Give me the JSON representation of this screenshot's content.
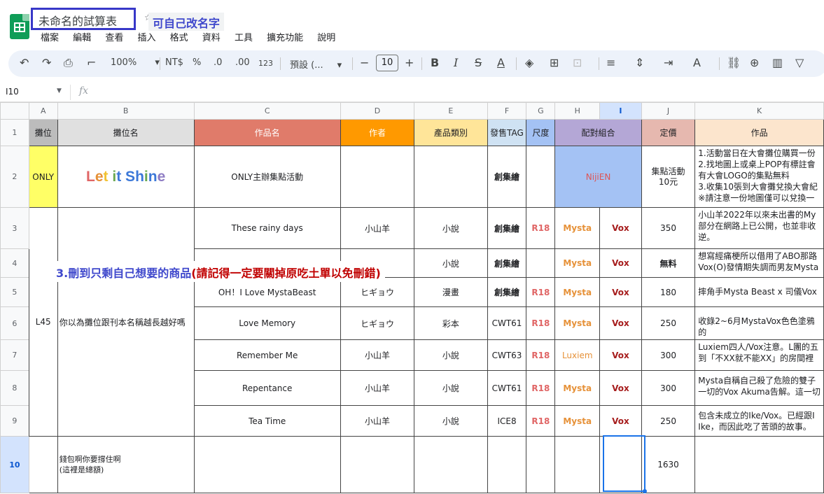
{
  "doc": {
    "title": "未命名的試算表",
    "star": "☆",
    "annotation": "可自己改名字"
  },
  "menu": [
    "檔案",
    "編輯",
    "查看",
    "插入",
    "格式",
    "資料",
    "工具",
    "擴充功能",
    "說明"
  ],
  "toolbar": {
    "zoom": "100%",
    "currency": "NT$",
    "percent": "%",
    "dec_less": ".0",
    "dec_more": ".00",
    "num_format": "123",
    "font": "預設 (...",
    "font_size": "10"
  },
  "formula_bar": {
    "cell_ref": "I10",
    "fx": "fx"
  },
  "columns": [
    "A",
    "B",
    "C",
    "D",
    "E",
    "F",
    "G",
    "H",
    "I",
    "J",
    "K"
  ],
  "header_row": {
    "a": "攤位",
    "b": "攤位名",
    "c": "作品名",
    "d": "作者",
    "e": "產品類別",
    "f": "發售TAG",
    "g": "尺度",
    "h": "配對組合",
    "j": "定價",
    "k": "作品"
  },
  "rows": [
    {
      "num": "2",
      "a": "ONLY",
      "b_letters": [
        "L",
        "e",
        "t",
        " ",
        "i",
        "t",
        " ",
        "S",
        "h",
        "i",
        "n",
        "e"
      ],
      "c": "ONLY主辦集點活動",
      "f": "創集繪",
      "h": "NijiEN",
      "j": "集點活動\n10元",
      "k": "1.活動當日在大會攤位購買一份\n2.找地圖上或桌上POP有標註會\n有大會LOGO的集點無料\n3.收集10張到大會攤兌換大會紀\n※請注意一份地圖僅可以兌換一"
    },
    {
      "num": "3",
      "c": "These rainy days",
      "d": "小山羊",
      "e": "小說",
      "f": "創集繪",
      "g": "R18",
      "h": "Mysta",
      "i": "Vox",
      "j": "350",
      "k": "小山羊2022年以來未出書的My\n部分在網路上已公開，也並非收\n逆。"
    },
    {
      "num": "4",
      "e": "小說",
      "f": "創集繪",
      "h": "Mysta",
      "i": "Vox",
      "j": "無料",
      "k": "想寫經痛梗所以借用了ABO那路\nVox(O)發情期失調而男友Mysta"
    },
    {
      "num": "5",
      "c": "OH！I Love MystaBeast",
      "d": "ヒギョウ",
      "e": "漫畫",
      "f": "創集繪",
      "g": "R18",
      "h": "Mysta",
      "i": "Vox",
      "j": "180",
      "k": "摔角手Mysta Beast x 司儀Vox"
    },
    {
      "num": "6",
      "a": "L45",
      "b": "你以為攤位跟刊本名稱越長越好嗎",
      "c": "Love Memory",
      "d": "ヒギョウ",
      "e": "彩本",
      "f": "CWT61",
      "g": "R18",
      "h": "Mysta",
      "i": "Vox",
      "j": "250",
      "k": "收錄2~6月MystaVox色色塗鴉的"
    },
    {
      "num": "7",
      "c": "Remember Me",
      "d": "小山羊",
      "e": "小說",
      "f": "CWT63",
      "g": "R18",
      "h": "Luxiem",
      "i": "Vox",
      "j": "300",
      "k": "Luxiem四人/Vox注意。L團的五\n到「不XX就不能XX」的房間裡"
    },
    {
      "num": "8",
      "c": "Repentance",
      "d": "小山羊",
      "e": "小說",
      "f": "CWT61",
      "g": "R18",
      "h": "Mysta",
      "i": "Vox",
      "j": "300",
      "k": "Mysta自稱自己殺了危險的雙子\n一切的Vox Akuma告解。這一切"
    },
    {
      "num": "9",
      "c": "Tea Time",
      "d": "小山羊",
      "e": "小說",
      "f": "ICE8",
      "g": "R18",
      "h": "Mysta",
      "i": "Vox",
      "j": "250",
      "k": "包含未成立的Ike/Vox。已經跟I\nIke，而因此吃了苦頭的故事。"
    },
    {
      "num": "10",
      "b": "錢包啊你要撐住啊\n(這裡是總額)",
      "j": "1630"
    }
  ],
  "row1_num": "1",
  "annotation_step": {
    "main": "3.刪到只剩自己想要的商品",
    "note": "(請記得一定要關掉原吃土單以免刪錯)"
  },
  "colors": {
    "accent": "#3f48cc",
    "col_a": "#bcbcbc",
    "col_b": "#e0e0e0",
    "col_c": "#e07b6a",
    "col_d": "#ff9900",
    "col_e": "#ffe599",
    "col_f": "#cfe2f3",
    "col_g": "#a4c2f4",
    "col_h": "#b4a7d6",
    "col_j": "#e6b8af",
    "col_k": "#fce5cd",
    "only_bg": "#ffff66",
    "niji_bg": "#a4c2f4"
  },
  "shine_colors": [
    "#e06666",
    "#e69138",
    "#f1c232",
    "#6aa84f",
    "#6aa84f",
    "#3c78d8",
    "#8e7cc3",
    "#3c78d8",
    "#3c78d8",
    "#6aa84f",
    "#3c78d8",
    "#8e7cc3"
  ]
}
